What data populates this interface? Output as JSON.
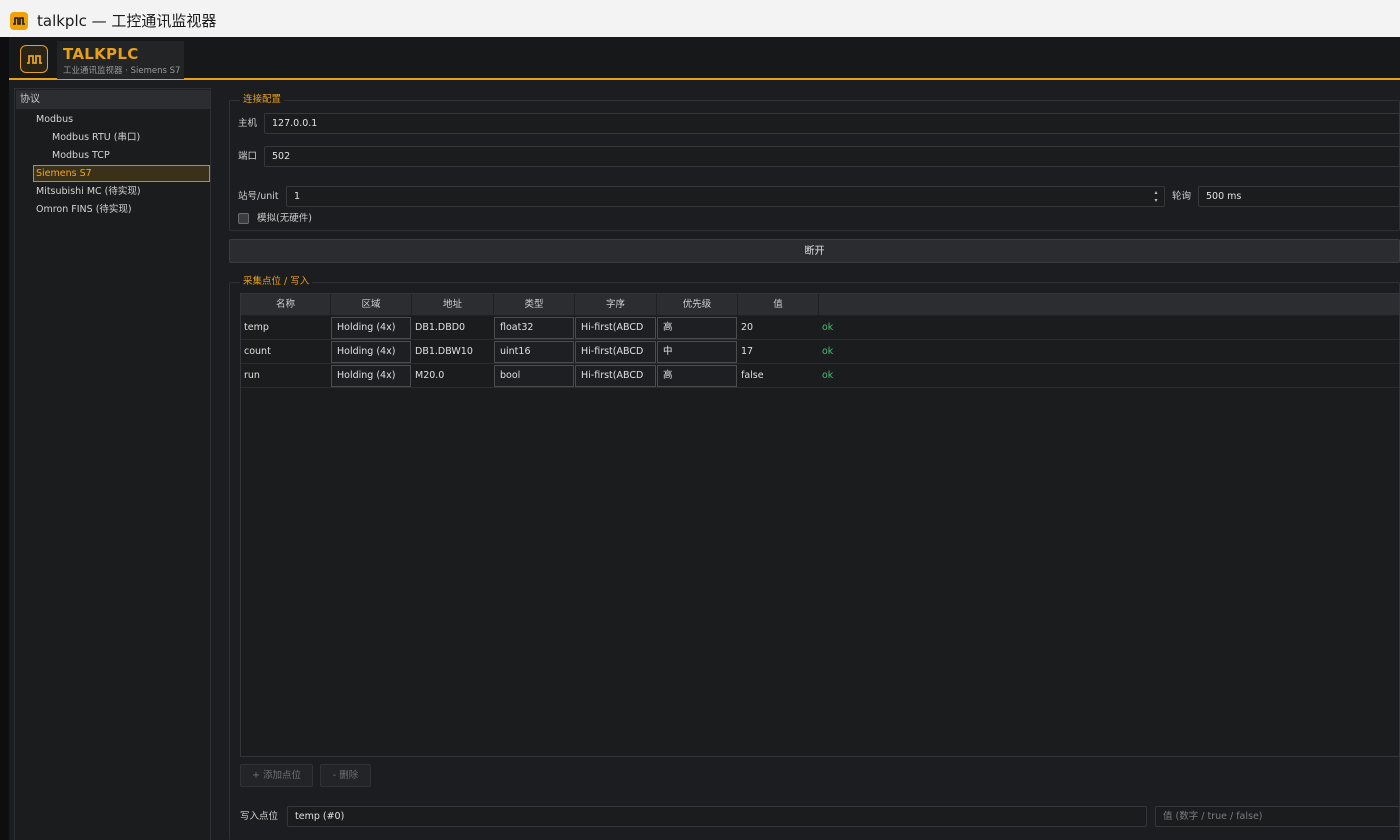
{
  "window": {
    "title": "talkplc — 工控通讯监视器"
  },
  "header": {
    "brand_name": "TALKPLC",
    "subtitle": "工业通讯监视器 · Siemens S7",
    "accent_color": "#e8a117"
  },
  "sidebar": {
    "header": "协议",
    "items": [
      {
        "label": "Modbus",
        "level": 1,
        "selected": false
      },
      {
        "label": "Modbus RTU (串口)",
        "level": 2,
        "selected": false
      },
      {
        "label": "Modbus TCP",
        "level": 2,
        "selected": false
      },
      {
        "label": "Siemens S7",
        "level": 1,
        "selected": true
      },
      {
        "label": "Mitsubishi MC (待实现)",
        "level": 1,
        "selected": false
      },
      {
        "label": "Omron FINS (待实现)",
        "level": 1,
        "selected": false
      }
    ]
  },
  "connection": {
    "title": "连接配置",
    "host_label": "主机",
    "host_value": "127.0.0.1",
    "port_label": "端口",
    "port_value": "502",
    "station_label": "站号/unit",
    "station_value": "1",
    "poll_label": "轮询",
    "poll_value": "500 ms",
    "simulate_label": "模拟(无硬件)",
    "simulate_checked": false,
    "disconnect_label": "断开"
  },
  "points": {
    "title": "采集点位 / 写入",
    "columns": [
      "名称",
      "区域",
      "地址",
      "类型",
      "字序",
      "优先级",
      "值"
    ],
    "rows": [
      {
        "name": "temp",
        "area": "Holding (4x)",
        "address": "DB1.DBD0",
        "type": "float32",
        "order": "Hi-first(ABCD",
        "priority": "高",
        "value": "20",
        "status": "ok"
      },
      {
        "name": "count",
        "area": "Holding (4x)",
        "address": "DB1.DBW10",
        "type": "uint16",
        "order": "Hi-first(ABCD",
        "priority": "中",
        "value": "17",
        "status": "ok"
      },
      {
        "name": "run",
        "area": "Holding (4x)",
        "address": "M20.0",
        "type": "bool",
        "order": "Hi-first(ABCD",
        "priority": "高",
        "value": "false",
        "status": "ok"
      }
    ],
    "add_label": "+ 添加点位",
    "delete_label": "- 删除",
    "status_color": "#43c06b"
  },
  "write": {
    "label": "写入点位",
    "point_value": "temp (#0)",
    "value_placeholder": "值 (数字 / true / false)"
  }
}
